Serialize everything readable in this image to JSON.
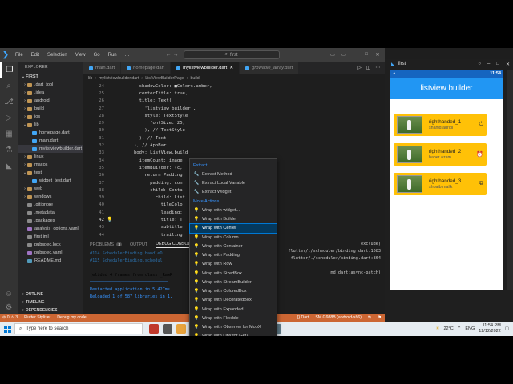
{
  "window": {
    "menu": [
      "File",
      "Edit",
      "Selection",
      "View",
      "Go",
      "Run",
      "…"
    ],
    "search": "first",
    "controls": [
      "▭",
      "▭",
      "–",
      "□",
      "✕"
    ]
  },
  "sidebar": {
    "header": "EXPLORER",
    "root": "FIRST",
    "tree": [
      {
        "label": ".dart_tool",
        "depth": 1,
        "kind": "folder"
      },
      {
        "label": ".idea",
        "depth": 1,
        "kind": "folder"
      },
      {
        "label": "android",
        "depth": 1,
        "kind": "folder"
      },
      {
        "label": "build",
        "depth": 1,
        "kind": "folder"
      },
      {
        "label": "ios",
        "depth": 1,
        "kind": "folder"
      },
      {
        "label": "lib",
        "depth": 1,
        "kind": "folder-open"
      },
      {
        "label": "homepage.dart",
        "depth": 2,
        "kind": "dart"
      },
      {
        "label": "main.dart",
        "depth": 2,
        "kind": "dart"
      },
      {
        "label": "mylistviewbuilder.dart",
        "depth": 2,
        "kind": "dart",
        "selected": true
      },
      {
        "label": "linux",
        "depth": 1,
        "kind": "folder"
      },
      {
        "label": "macos",
        "depth": 1,
        "kind": "folder"
      },
      {
        "label": "test",
        "depth": 1,
        "kind": "folder-open"
      },
      {
        "label": "widget_test.dart",
        "depth": 2,
        "kind": "dart"
      },
      {
        "label": "web",
        "depth": 1,
        "kind": "folder"
      },
      {
        "label": "windows",
        "depth": 1,
        "kind": "folder"
      },
      {
        "label": ".gitignore",
        "depth": 1,
        "kind": "file"
      },
      {
        "label": ".metadata",
        "depth": 1,
        "kind": "file"
      },
      {
        "label": ".packages",
        "depth": 1,
        "kind": "file"
      },
      {
        "label": "analysis_options.yaml",
        "depth": 1,
        "kind": "yaml"
      },
      {
        "label": "first.iml",
        "depth": 1,
        "kind": "file"
      },
      {
        "label": "pubspec.lock",
        "depth": 1,
        "kind": "file"
      },
      {
        "label": "pubspec.yaml",
        "depth": 1,
        "kind": "yaml"
      },
      {
        "label": "README.md",
        "depth": 1,
        "kind": "md"
      }
    ],
    "sections": [
      "OUTLINE",
      "TIMELINE",
      "DEPENDENCIES"
    ]
  },
  "tabs": [
    {
      "label": "main.dart"
    },
    {
      "label": "homepage.dart"
    },
    {
      "label": "mylistviewbuilder.dart",
      "active": true
    },
    {
      "label": "growable_array.dart"
    }
  ],
  "breadcrumb": [
    "lib",
    "mylistviewbuilder.dart",
    "ListViewBuilderPage",
    "build"
  ],
  "code": [
    {
      "n": "24",
      "t": "          shadowColor: ■Colors.amber,"
    },
    {
      "n": "25",
      "t": "          centerTitle: true,"
    },
    {
      "n": "26",
      "t": "          title: Text("
    },
    {
      "n": "27",
      "t": "            'listview builder',"
    },
    {
      "n": "28",
      "t": "            style: TextStyle"
    },
    {
      "n": "29",
      "t": "              fontSize: 25,"
    },
    {
      "n": "30",
      "t": "            ), // TextStyle"
    },
    {
      "n": "31",
      "t": "          ), // Text"
    },
    {
      "n": "32",
      "t": "        ), // AppBar"
    },
    {
      "n": "33",
      "t": "        body: ListView.build"
    },
    {
      "n": "34",
      "t": "          itemCount: image"
    },
    {
      "n": "35",
      "t": "          itemBuilder: (c,"
    },
    {
      "n": "36",
      "t": "            return Padding"
    },
    {
      "n": "37",
      "t": "              padding: con"
    },
    {
      "n": "38",
      "t": "              child: Conta"
    },
    {
      "n": "39",
      "t": "                child: List"
    },
    {
      "n": "40",
      "t": "                  tileColo"
    },
    {
      "n": "41",
      "t": "                  leading:"
    },
    {
      "n": "42",
      "t": "                  title: T",
      "current": true
    },
    {
      "n": "43",
      "t": "                  subtitle"
    },
    {
      "n": "44",
      "t": "                  trailing"
    },
    {
      "n": "45",
      "t": "                ), // List"
    }
  ],
  "context_menu": [
    {
      "label": "Extract...",
      "type": "group"
    },
    {
      "label": "Extract Method",
      "icon": "wrench"
    },
    {
      "label": "Extract Local Variable",
      "icon": "wrench"
    },
    {
      "label": "Extract Widget",
      "icon": "wrench"
    },
    {
      "label": "More Actions...",
      "type": "group"
    },
    {
      "label": "Wrap with widget...",
      "icon": "bulb"
    },
    {
      "label": "Wrap with Builder",
      "icon": "bulb"
    },
    {
      "label": "Wrap with Center",
      "icon": "bulb",
      "selected": true
    },
    {
      "label": "Wrap with Column",
      "icon": "bulb"
    },
    {
      "label": "Wrap with Container",
      "icon": "bulb"
    },
    {
      "label": "Wrap with Padding",
      "icon": "bulb"
    },
    {
      "label": "Wrap with Row",
      "icon": "bulb"
    },
    {
      "label": "Wrap with SizedBox",
      "icon": "bulb"
    },
    {
      "label": "Wrap with StreamBuilder",
      "icon": "bulb"
    },
    {
      "label": "Wrap with ColoredBox",
      "icon": "bulb"
    },
    {
      "label": "Wrap with DecoratedBox",
      "icon": "bulb"
    },
    {
      "label": "Wrap with Expanded",
      "icon": "bulb"
    },
    {
      "label": "Wrap with Flexible",
      "icon": "bulb"
    },
    {
      "label": "Wrap with Observer for MobX",
      "icon": "bulb"
    },
    {
      "label": "Wrap with Obx for GetX",
      "icon": "bulb"
    },
    {
      "label": "Wrap with Visibility",
      "icon": "bulb"
    },
    {
      "label": "Wrap with WillPopScope",
      "icon": "bulb"
    },
    {
      "label": "Flutter Tools - Wrap with widget...",
      "icon": "bulb"
    }
  ],
  "panel": {
    "tabs": [
      {
        "label": "PROBLEMS",
        "badge": "3"
      },
      {
        "label": "OUTPUT"
      },
      {
        "label": "DEBUG CONSOLE",
        "active": true
      }
    ],
    "log": [
      {
        "text": "#114    SchedulerBinding.handleD",
        "style": "dim"
      },
      {
        "text": "#115    SchedulerBinding.schedul",
        "style": "dim"
      },
      {
        "text": "  ",
        "style": "dim"
      },
      {
        "text": "(elided 4 frames from class _RawR",
        "style": "plain"
      },
      {
        "text": "═══════════════════════════════",
        "style": "blue"
      },
      {
        "text": "Restarted application in 5,427ms.",
        "style": "blue"
      },
      {
        "text": "Reloaded 1 of 587 libraries in 1,",
        "style": "blue"
      }
    ],
    "tail": [
      "exclude)",
      "flutter/./scheduler/binding.dart:1083",
      "flutter/./scheduler/binding.dart:864",
      "",
      "md dart:async-patch)"
    ]
  },
  "statusbar": {
    "left": [
      "⊘ 0  ⚠ 3",
      "Flutter Stylizer",
      "Debug my code"
    ],
    "right": [
      "{} Dart",
      "SM G988B (android-x86)",
      "↹",
      "⚑"
    ]
  },
  "emulator": {
    "title": "first",
    "controls": [
      "○",
      "–",
      "□",
      "✕"
    ],
    "status_time": "11:54",
    "appbar_title": "listview builder",
    "cards": [
      {
        "title": "righthanded_1",
        "subtitle": "shahid adridi",
        "icon": "⏻"
      },
      {
        "title": "righthanded_2",
        "subtitle": "baber azam",
        "icon": "⏰"
      },
      {
        "title": "righthanded_3",
        "subtitle": "shoaib malik",
        "icon": "⧉"
      }
    ]
  },
  "taskbar": {
    "search_placeholder": "Type here to search",
    "weather": "22°C",
    "lang": "ENG",
    "time": "11:54 PM",
    "date": "12/12/2022"
  },
  "colors": {
    "statusbar": "#cc6633",
    "appbar": "#2196f3",
    "card": "#ffc107",
    "selection": "#04395e"
  }
}
